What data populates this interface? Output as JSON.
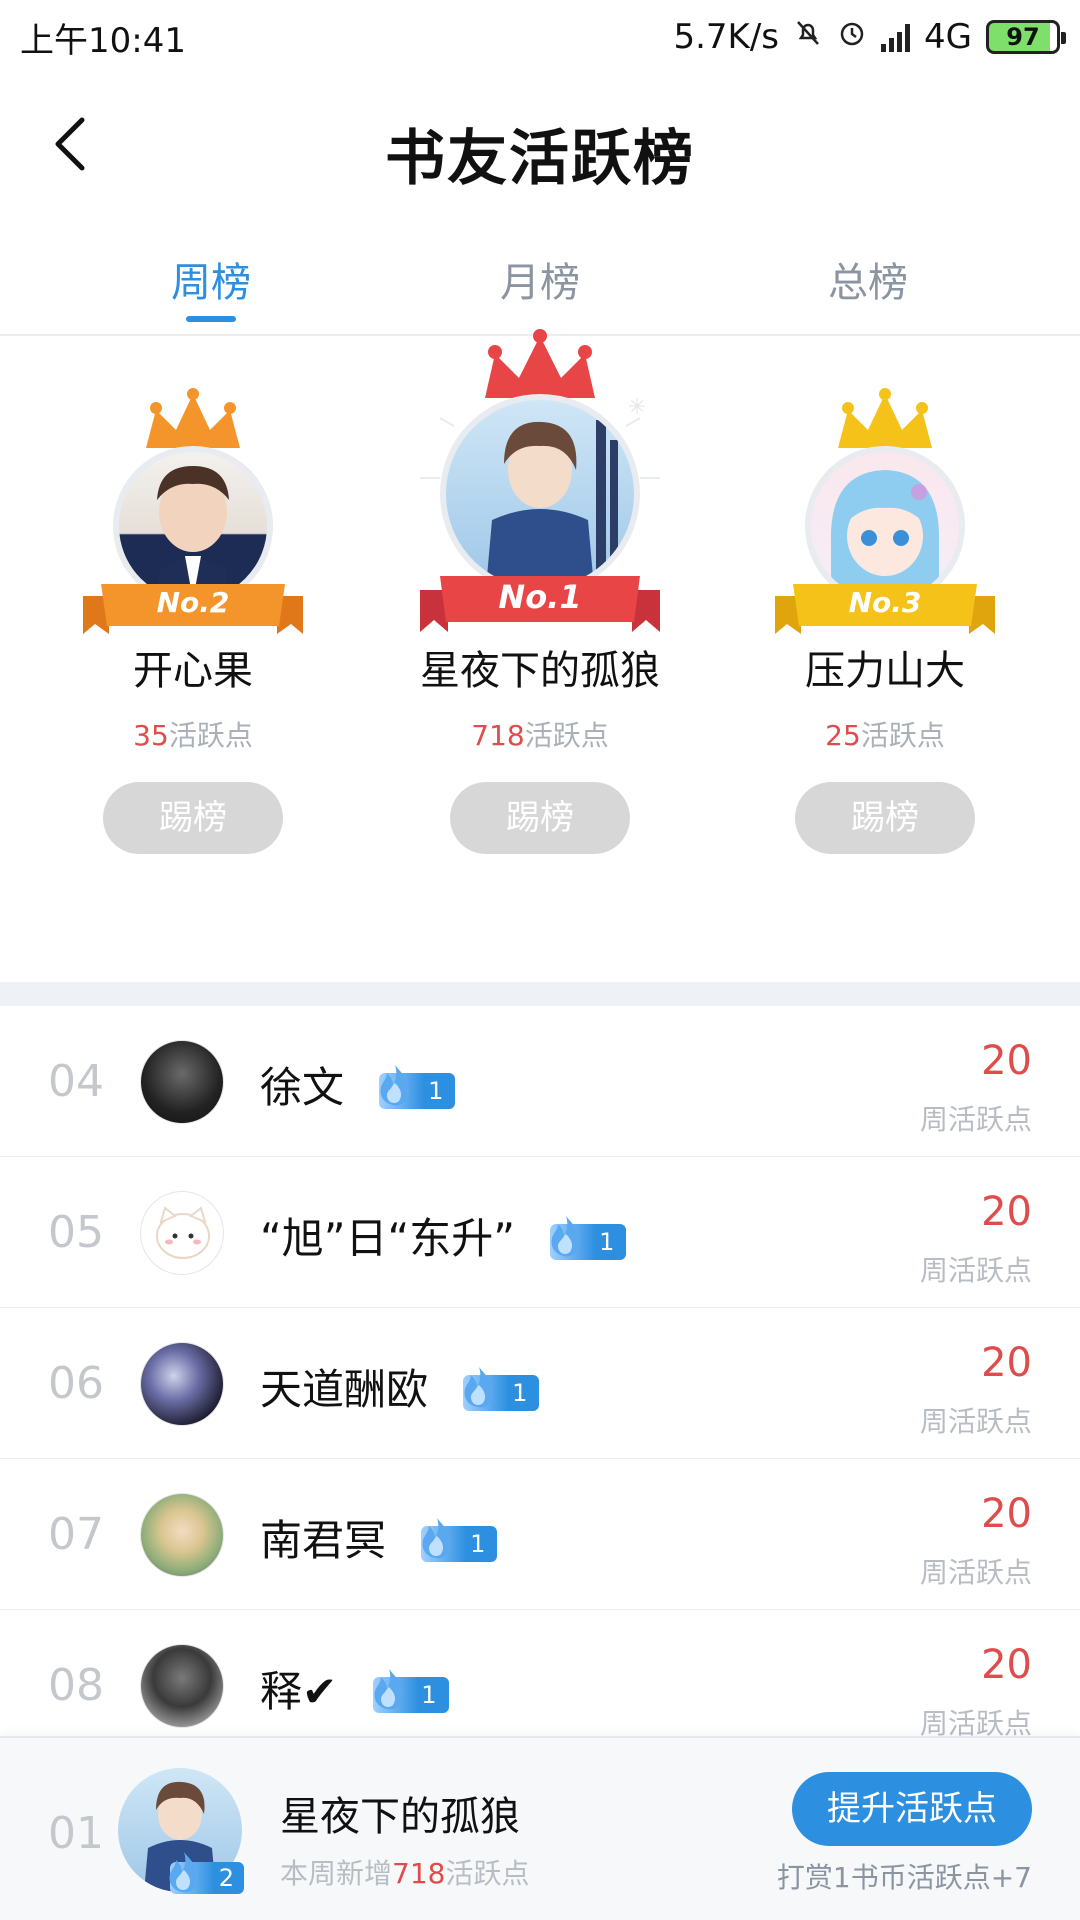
{
  "status_bar": {
    "time": "上午10:41",
    "speed": "5.7K/s",
    "network": "4G",
    "battery": "97"
  },
  "header": {
    "title": "书友活跃榜"
  },
  "tabs": [
    {
      "label": "周榜",
      "active": true
    },
    {
      "label": "月榜",
      "active": false
    },
    {
      "label": "总榜",
      "active": false
    }
  ],
  "podium": {
    "points_suffix": "活跃点",
    "kick_label": "踢榜",
    "first": {
      "rank_label": "No.1",
      "name": "星夜下的孤狼",
      "points": "718"
    },
    "second": {
      "rank_label": "No.2",
      "name": "开心果",
      "points": "35"
    },
    "third": {
      "rank_label": "No.3",
      "name": "压力山大",
      "points": "25"
    }
  },
  "list": {
    "value_label": "周活跃点",
    "rows": [
      {
        "rank": "04",
        "name": "徐文",
        "level": "1",
        "value": "20"
      },
      {
        "rank": "05",
        "name": "“旭”日“东升”",
        "level": "1",
        "value": "20"
      },
      {
        "rank": "06",
        "name": "天道酬欧",
        "level": "1",
        "value": "20"
      },
      {
        "rank": "07",
        "name": "南君冥",
        "level": "1",
        "value": "20"
      },
      {
        "rank": "08",
        "name": "释✔",
        "level": "1",
        "value": "20"
      }
    ]
  },
  "me": {
    "rank": "01",
    "name": "星夜下的孤狼",
    "level": "2",
    "sub_prefix": "本周新增",
    "sub_value": "718",
    "sub_suffix": "活跃点",
    "boost_label": "提升活跃点",
    "boost_note": "打赏1书币活跃点+7"
  },
  "colors": {
    "accent": "#2d8fe0",
    "points_red": "#e04b4b",
    "crown_gold": "#f5c21a",
    "crown_orange": "#f3952b",
    "crown_red": "#e84646"
  }
}
